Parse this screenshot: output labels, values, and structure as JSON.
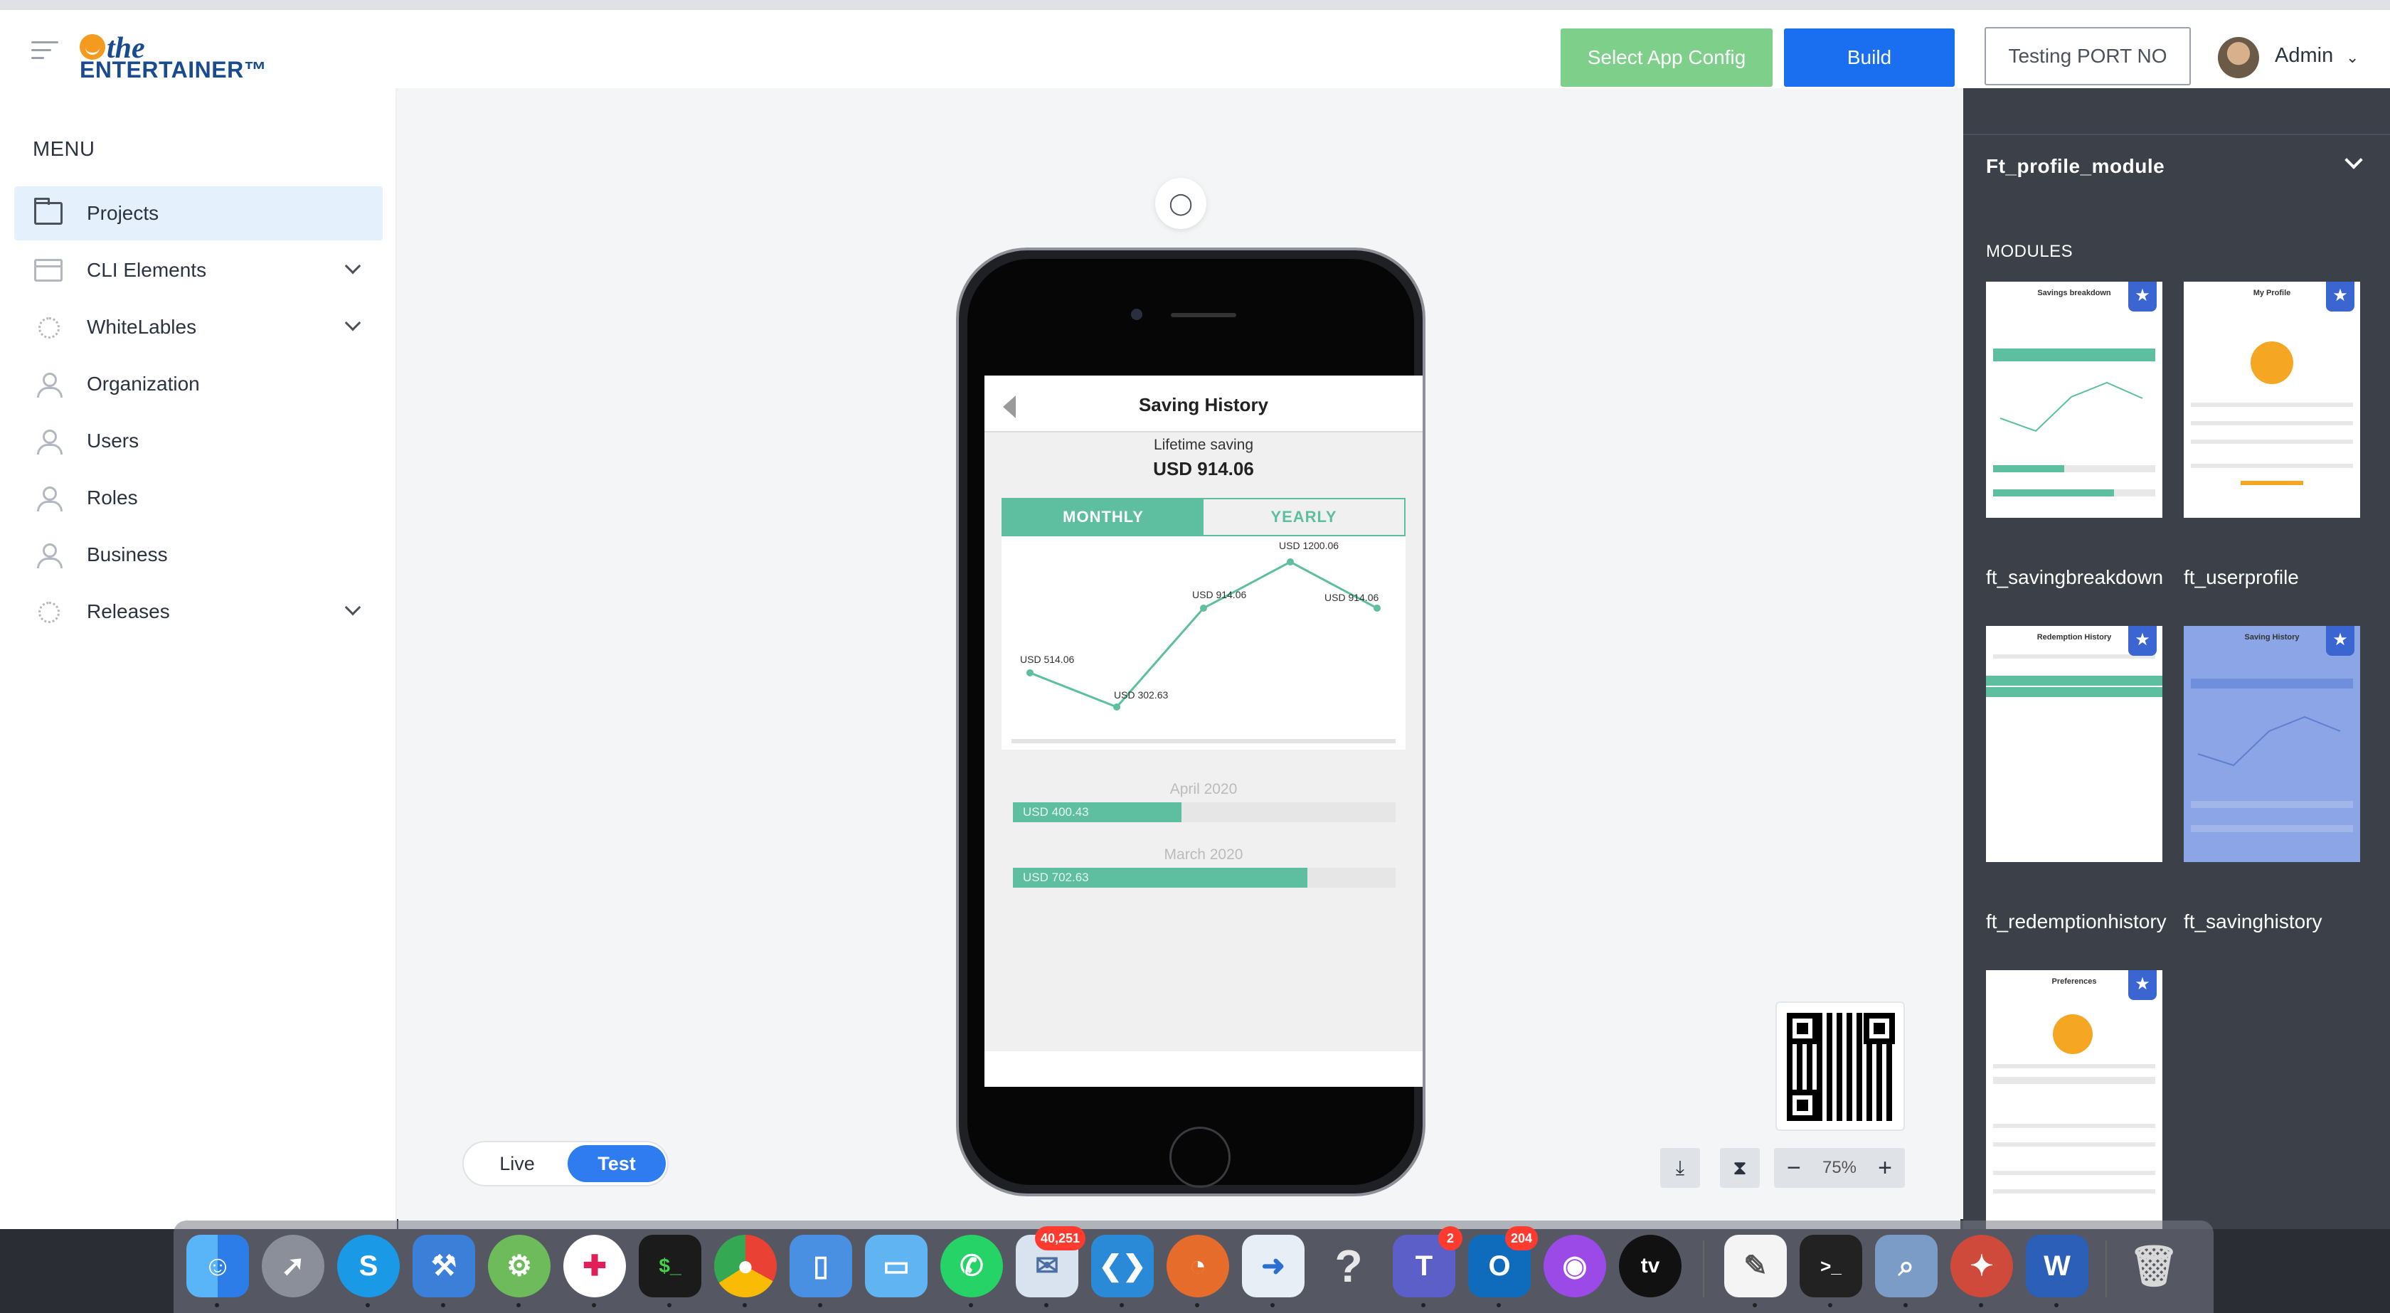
{
  "header": {
    "logo_the": "the",
    "logo_entertainer": "ENTERTAINER™",
    "select_config_label": "Select App Config",
    "build_label": "Build",
    "port_label": "Testing PORT NO",
    "user_label": "Admin"
  },
  "sidebar": {
    "title": "MENU",
    "items": [
      {
        "label": "Projects"
      },
      {
        "label": "CLI Elements"
      },
      {
        "label": "WhiteLables"
      },
      {
        "label": "Organization"
      },
      {
        "label": "Users"
      },
      {
        "label": "Roles"
      },
      {
        "label": "Business"
      },
      {
        "label": "Releases"
      }
    ]
  },
  "preview": {
    "screen_title": "Saving History",
    "lifetime_label": "Lifetime saving",
    "lifetime_amount": "USD 914.06",
    "tabs": [
      "MONTHLY",
      "YEARLY"
    ],
    "chart_points": [
      {
        "label": "USD 514.06",
        "value": 514.06
      },
      {
        "label": "USD 302.63",
        "value": 302.63
      },
      {
        "label": "USD 914.06",
        "value": 914.06
      },
      {
        "label": "USD 1200.06",
        "value": 1200.06
      },
      {
        "label": "USD 914.06",
        "value": 914.06
      }
    ],
    "months": [
      {
        "label": "April 2020",
        "amount": "USD 400.43",
        "fill": 0.44
      },
      {
        "label": "March 2020",
        "amount": "USD 702.63",
        "fill": 0.77
      }
    ]
  },
  "mode": {
    "live": "Live",
    "test": "Test"
  },
  "zoom": {
    "value": "75%"
  },
  "panel": {
    "module_group": "Ft_profile_module",
    "modules_title": "MODULES",
    "modules": [
      {
        "name": "ft_savingbreakdown",
        "mini_title": "Savings breakdown"
      },
      {
        "name": "ft_userprofile",
        "mini_title": "My Profile"
      },
      {
        "name": "ft_redemptionhistory",
        "mini_title": "Redemption History"
      },
      {
        "name": "ft_savinghistory",
        "mini_title": "Saving History"
      },
      {
        "name": "",
        "mini_title": "Preferences"
      }
    ]
  },
  "dock": {
    "mail_badge": "40,251",
    "teams_badge": "2",
    "outlook_badge": "204",
    "apps": [
      "finder",
      "launchpad",
      "skype",
      "xcode",
      "android-studio",
      "slack",
      "terminal",
      "chrome",
      "simulator",
      "files",
      "whatsapp",
      "mail",
      "vscode",
      "sourcetree",
      "migration",
      "help",
      "teams",
      "outlook",
      "podcasts",
      "appletv",
      "textedit",
      "terminal2",
      "preview",
      "safari-dev",
      "word",
      "trash"
    ],
    "appletv_text": "tv",
    "help_text": "?",
    "teams_text": "T",
    "outlook_text": "O",
    "word_text": "W",
    "skype_text": "S",
    "terminal_text": "$_"
  },
  "colors": {
    "accent": "#1a6ef0",
    "green": "#5dbfa0",
    "config_btn": "#7ecf8a",
    "panel_bg": "#3b4049"
  }
}
